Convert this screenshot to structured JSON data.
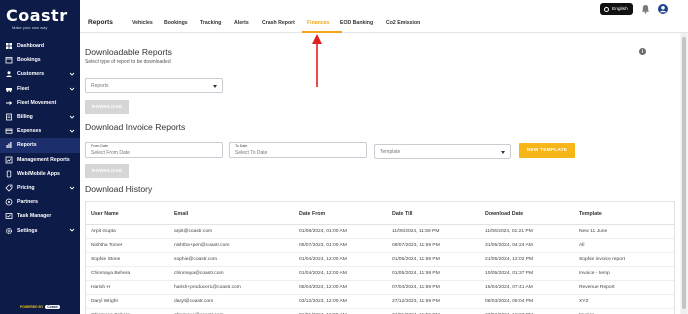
{
  "brand": {
    "name": "Coastr",
    "tagline": "Make your own way",
    "powered_prefix": "POWERED BY",
    "powered_brand": "Coastr"
  },
  "sidebar": {
    "items": [
      {
        "label": "Dashboard",
        "icon": "dashboard-icon",
        "chevron": false,
        "active": false
      },
      {
        "label": "Bookings",
        "icon": "bookings-icon",
        "chevron": false,
        "active": false
      },
      {
        "label": "Customers",
        "icon": "customers-icon",
        "chevron": true,
        "active": false
      },
      {
        "label": "Fleet",
        "icon": "car-icon",
        "chevron": true,
        "active": false
      },
      {
        "label": "Fleet Movement",
        "icon": "fleet-movement-icon",
        "chevron": false,
        "active": false
      },
      {
        "label": "Billing",
        "icon": "billing-icon",
        "chevron": true,
        "active": false
      },
      {
        "label": "Expenses",
        "icon": "expenses-icon",
        "chevron": true,
        "active": false
      },
      {
        "label": "Reports",
        "icon": "reports-icon",
        "chevron": false,
        "active": true
      },
      {
        "label": "Management Reports",
        "icon": "management-reports-icon",
        "chevron": false,
        "active": false
      },
      {
        "label": "Web/Mobile Apps",
        "icon": "apps-icon",
        "chevron": false,
        "active": false
      },
      {
        "label": "Pricing",
        "icon": "pricing-icon",
        "chevron": true,
        "active": false
      },
      {
        "label": "Partners",
        "icon": "partners-icon",
        "chevron": false,
        "active": false
      },
      {
        "label": "Task Manager",
        "icon": "task-manager-icon",
        "chevron": false,
        "active": false
      },
      {
        "label": "Settings",
        "icon": "settings-icon",
        "chevron": true,
        "active": false
      }
    ]
  },
  "topbar": {
    "title": "Reports",
    "tabs": [
      {
        "label": "Vehicles"
      },
      {
        "label": "Bookings"
      },
      {
        "label": "Tracking"
      },
      {
        "label": "Alerts"
      },
      {
        "label": "Crash Report"
      },
      {
        "label": "Finances",
        "active": true
      },
      {
        "label": "EOD Banking"
      },
      {
        "label": "Co2 Emission"
      }
    ],
    "language": "English"
  },
  "downloadable": {
    "title": "Downloadable Reports",
    "subtitle": "Select type of report to be downloaded",
    "select_placeholder": "Reports",
    "download_label": "DOWNLOAD"
  },
  "invoice": {
    "title": "Download Invoice Reports",
    "from_label": "From Date",
    "from_placeholder": "Select From Date",
    "to_label": "To Date",
    "to_placeholder": "Select To Date",
    "template_placeholder": "Template",
    "new_template_label": "NEW TEMPLATE",
    "download_label": "DOWNLOAD"
  },
  "history": {
    "title": "Download History",
    "columns": [
      "User Name",
      "Email",
      "Date From",
      "Date Till",
      "Download Date",
      "Template"
    ],
    "rows": [
      [
        "Arpit Gupta",
        "arpit@coastr.com",
        "01/06/2024, 01:00 AM",
        "11/06/2024, 11:59 PM",
        "11/06/2024, 01:21 PM",
        "New 11 June"
      ],
      [
        "Nishtha Tomer",
        "nishtha+pen@coastr.com",
        "05/07/2023, 01:00 AM",
        "09/07/2023, 11:59 PM",
        "31/05/2024, 04:24 AM",
        "All"
      ],
      [
        "Sophie Stone",
        "sophie@coastr.com",
        "01/04/2024, 12:00 AM",
        "01/05/2024, 11:59 PM",
        "21/05/2024, 12:02 PM",
        "Sophie invoice report"
      ],
      [
        "Chinmaya Behera",
        "chinmaya@coastr.com",
        "01/04/2024, 12:00 AM",
        "01/05/2024, 11:59 PM",
        "10/05/2024, 01:37 PM",
        "Invoice - temp"
      ],
      [
        "Harish H",
        "harish+producer1@coastr.com",
        "05/04/2024, 12:00 AM",
        "07/04/2024, 11:59 PM",
        "16/04/2024, 07:41 AM",
        "Revenue Report"
      ],
      [
        "Daryl Wright",
        "daryl@coastr.com",
        "03/12/2023, 12:00 AM",
        "27/12/2023, 11:59 PM",
        "08/03/2024, 09:04 PM",
        "XYZ"
      ],
      [
        "Chinmaya Behera",
        "chinmaya@coastr.com",
        "01/01/2024, 12:00 AM",
        "31/01/2024, 11:59 PM",
        "27/02/2024, 12:37 PM",
        "Invoice"
      ]
    ]
  },
  "colors": {
    "sidebar": "#0d1b48",
    "accent": "#f2a516",
    "button_yellow": "#f7b618",
    "arrow": "#e0201e"
  }
}
